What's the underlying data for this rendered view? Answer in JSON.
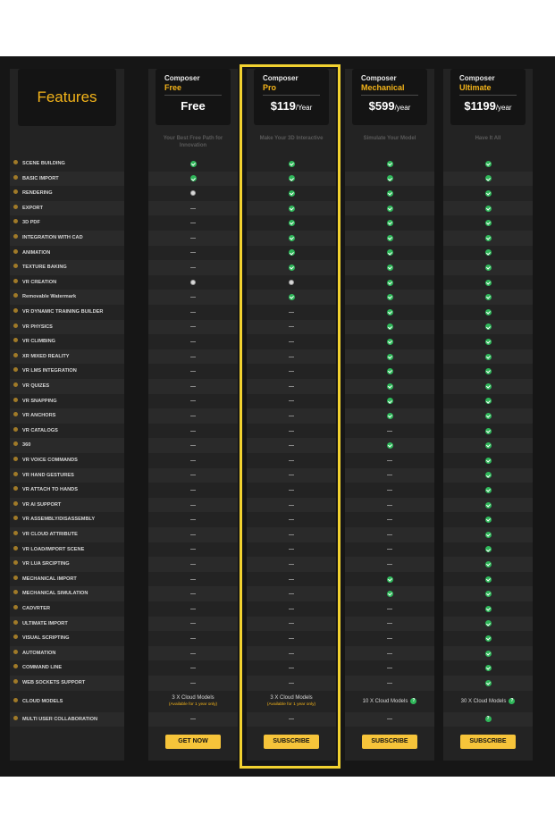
{
  "features_title": "Features",
  "plans": [
    {
      "key": "free",
      "name_top": "Composer",
      "name_bottom": "Free",
      "price": "Free",
      "per": "",
      "tagline": "Your Best Free Path for Innovation",
      "button": "GET NOW"
    },
    {
      "key": "pro",
      "name_top": "Composer",
      "name_bottom": "Pro",
      "price": "$119",
      "per": "/Year",
      "tagline": "Make Your 3D Interactive",
      "button": "SUBSCRIBE"
    },
    {
      "key": "mech",
      "name_top": "Composer",
      "name_bottom": "Mechanical",
      "price": "$599",
      "per": "/year",
      "tagline": "Simulate Your Model",
      "button": "SUBSCRIBE"
    },
    {
      "key": "ult",
      "name_top": "Composer",
      "name_bottom": "Ultimate",
      "price": "$1199",
      "per": "/year",
      "tagline": "Have It All",
      "button": "SUBSCRIBE"
    }
  ],
  "features": [
    {
      "name": "SCENE BUILDING",
      "free": "check",
      "pro": "check",
      "mech": "check",
      "ult": "check"
    },
    {
      "name": "BASIC IMPORT",
      "free": "check",
      "pro": "check",
      "mech": "check",
      "ult": "check"
    },
    {
      "name": "RENDERING",
      "free": "partial",
      "pro": "check",
      "mech": "check",
      "ult": "check"
    },
    {
      "name": "EXPORT",
      "free": "none",
      "pro": "check",
      "mech": "check",
      "ult": "check"
    },
    {
      "name": "3D PDF",
      "free": "none",
      "pro": "check",
      "mech": "check",
      "ult": "check"
    },
    {
      "name": "INTEGRATION WITH CAD",
      "free": "none",
      "pro": "check",
      "mech": "check",
      "ult": "check"
    },
    {
      "name": "ANIMATION",
      "free": "none",
      "pro": "check",
      "mech": "check",
      "ult": "check"
    },
    {
      "name": "TEXTURE BAKING",
      "free": "none",
      "pro": "check",
      "mech": "check",
      "ult": "check"
    },
    {
      "name": "VR CREATION",
      "free": "partial",
      "pro": "partial",
      "mech": "check",
      "ult": "check"
    },
    {
      "name": "Removable Watermark",
      "free": "none",
      "pro": "check",
      "mech": "check",
      "ult": "check"
    },
    {
      "name": "VR DYNAMIC TRAINING BUILDER",
      "free": "none",
      "pro": "none",
      "mech": "check",
      "ult": "check"
    },
    {
      "name": "VR PHYSICS",
      "free": "none",
      "pro": "none",
      "mech": "check",
      "ult": "check"
    },
    {
      "name": "VR CLIMBING",
      "free": "none",
      "pro": "none",
      "mech": "check",
      "ult": "check"
    },
    {
      "name": "XR MIXED REALITY",
      "free": "none",
      "pro": "none",
      "mech": "check",
      "ult": "check"
    },
    {
      "name": "VR LMS INTEGRATION",
      "free": "none",
      "pro": "none",
      "mech": "check",
      "ult": "check"
    },
    {
      "name": "VR QUIZES",
      "free": "none",
      "pro": "none",
      "mech": "check",
      "ult": "check"
    },
    {
      "name": "VR SNAPPING",
      "free": "none",
      "pro": "none",
      "mech": "check",
      "ult": "check"
    },
    {
      "name": "VR ANCHORS",
      "free": "none",
      "pro": "none",
      "mech": "check",
      "ult": "check"
    },
    {
      "name": "VR CATALOGS",
      "free": "none",
      "pro": "none",
      "mech": "none",
      "ult": "check"
    },
    {
      "name": "360",
      "free": "none",
      "pro": "none",
      "mech": "check",
      "ult": "check"
    },
    {
      "name": "VR VOICE COMMANDS",
      "free": "none",
      "pro": "none",
      "mech": "none",
      "ult": "check"
    },
    {
      "name": "VR HAND GESTURES",
      "free": "none",
      "pro": "none",
      "mech": "none",
      "ult": "check"
    },
    {
      "name": "VR ATTACH TO HANDS",
      "free": "none",
      "pro": "none",
      "mech": "none",
      "ult": "check"
    },
    {
      "name": "VR AI SUPPORT",
      "free": "none",
      "pro": "none",
      "mech": "none",
      "ult": "check"
    },
    {
      "name": "VR ASSEMBLY/DISASSEMBLY",
      "free": "none",
      "pro": "none",
      "mech": "none",
      "ult": "check"
    },
    {
      "name": "VR CLOUD ATTRIBUTE",
      "free": "none",
      "pro": "none",
      "mech": "none",
      "ult": "check"
    },
    {
      "name": "VR LOAD/IMPORT SCENE",
      "free": "none",
      "pro": "none",
      "mech": "none",
      "ult": "check"
    },
    {
      "name": "VR LUA SRCIPTING",
      "free": "none",
      "pro": "none",
      "mech": "none",
      "ult": "check"
    },
    {
      "name": "MECHANICAL IMPORT",
      "free": "none",
      "pro": "none",
      "mech": "check",
      "ult": "check"
    },
    {
      "name": "MECHANICAL SIMULATION",
      "free": "none",
      "pro": "none",
      "mech": "check",
      "ult": "check"
    },
    {
      "name": "CADVRTER",
      "free": "none",
      "pro": "none",
      "mech": "none",
      "ult": "check"
    },
    {
      "name": "ULTIMATE IMPORT",
      "free": "none",
      "pro": "none",
      "mech": "none",
      "ult": "check"
    },
    {
      "name": "VISUAL SCRIPTING",
      "free": "none",
      "pro": "none",
      "mech": "none",
      "ult": "check"
    },
    {
      "name": "AUTOMATION",
      "free": "none",
      "pro": "none",
      "mech": "none",
      "ult": "check"
    },
    {
      "name": "COMMAND LINE",
      "free": "none",
      "pro": "none",
      "mech": "none",
      "ult": "check"
    },
    {
      "name": "WEB SOCKETS SUPPORT",
      "free": "none",
      "pro": "none",
      "mech": "none",
      "ult": "check"
    }
  ],
  "cloud_models": {
    "label": "CLOUD MODELS",
    "free": {
      "main": "3 X Cloud Models",
      "sub": "(Available for 1 year only)"
    },
    "pro": {
      "main": "3 X Cloud Models",
      "sub": "(Available for 1 year only)"
    },
    "mech": {
      "main": "10 X Cloud Models",
      "help": "?"
    },
    "ult": {
      "main": "30 X Cloud Models",
      "help": "?"
    }
  },
  "multi_user": {
    "label": "MULTI USER COLLABORATION",
    "free": "none",
    "pro": "none",
    "mech": "none",
    "ult": "help"
  },
  "colors": {
    "accent": "#f4b41a",
    "check": "#2fb85a",
    "highlight_border": "#f2d230",
    "button": "#f6c43a"
  }
}
